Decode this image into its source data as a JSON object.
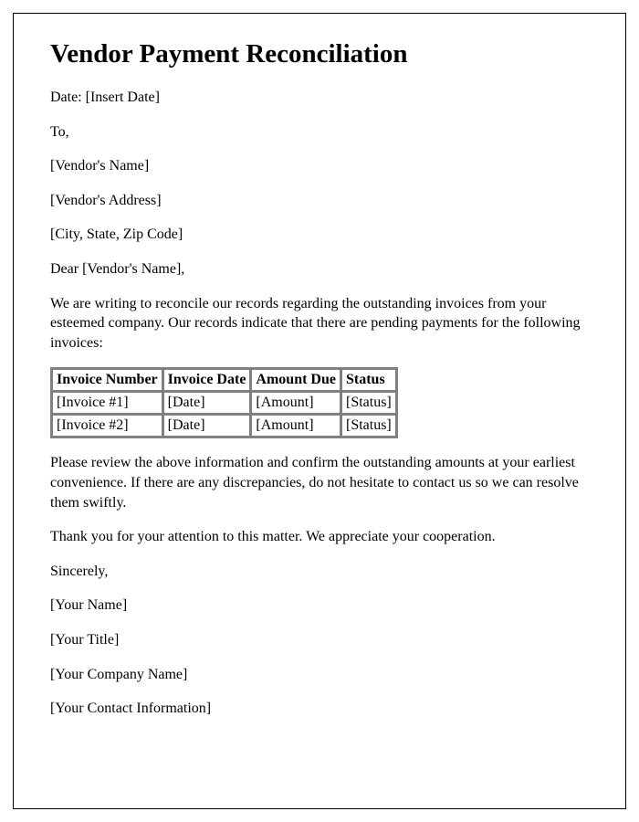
{
  "title": "Vendor Payment Reconciliation",
  "date_line": "Date: [Insert Date]",
  "to_line": "To,",
  "vendor_name": "[Vendor's Name]",
  "vendor_address": "[Vendor's Address]",
  "city_state_zip": "[City, State, Zip Code]",
  "salutation": "Dear [Vendor's Name],",
  "intro_paragraph": "We are writing to reconcile our records regarding the outstanding invoices from your esteemed company. Our records indicate that there are pending payments for the following invoices:",
  "table": {
    "headers": [
      "Invoice Number",
      "Invoice Date",
      "Amount Due",
      "Status"
    ],
    "rows": [
      [
        "[Invoice #1]",
        "[Date]",
        "[Amount]",
        "[Status]"
      ],
      [
        "[Invoice #2]",
        "[Date]",
        "[Amount]",
        "[Status]"
      ]
    ]
  },
  "review_paragraph": "Please review the above information and confirm the outstanding amounts at your earliest convenience. If there are any discrepancies, do not hesitate to contact us so we can resolve them swiftly.",
  "thanks_paragraph": "Thank you for your attention to this matter. We appreciate your cooperation.",
  "closing": "Sincerely,",
  "signer_name": "[Your Name]",
  "signer_title": "[Your Title]",
  "company_name": "[Your Company Name]",
  "contact_info": "[Your Contact Information]"
}
